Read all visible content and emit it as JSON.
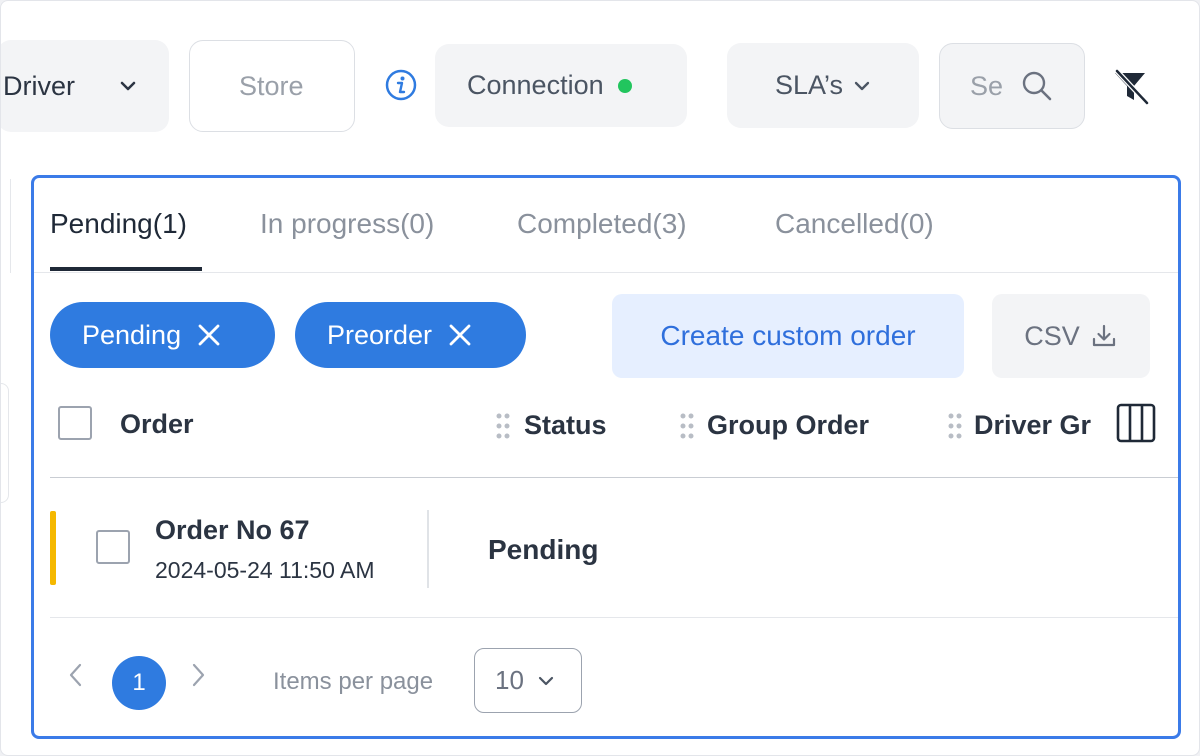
{
  "toolbar": {
    "driver_label": "Driver",
    "store_placeholder": "Store",
    "connection_label": "Connection",
    "connection_status_color": "#22c55e",
    "sla_label": "SLA’s",
    "search_placeholder": "Se"
  },
  "tabs": [
    {
      "label": "Pending(1)",
      "active": true
    },
    {
      "label": "In progress(0)",
      "active": false
    },
    {
      "label": "Completed(3)",
      "active": false
    },
    {
      "label": "Cancelled(0)",
      "active": false
    }
  ],
  "filters": [
    {
      "label": "Pending"
    },
    {
      "label": "Preorder"
    }
  ],
  "actions": {
    "create_label": "Create custom order",
    "csv_label": "CSV"
  },
  "table": {
    "columns": [
      "Order",
      "Status",
      "Group Order",
      "Driver Gr"
    ],
    "rows": [
      {
        "order_no": "Order No 67",
        "date": "2024-05-24 11:50 AM",
        "status": "Pending",
        "indicator_color": "#f5b800"
      }
    ]
  },
  "pagination": {
    "current_page": "1",
    "items_per_page_label": "Items per page",
    "items_per_page_value": "10"
  },
  "colors": {
    "accent": "#2f7be0",
    "card_border": "#3b7be8"
  }
}
